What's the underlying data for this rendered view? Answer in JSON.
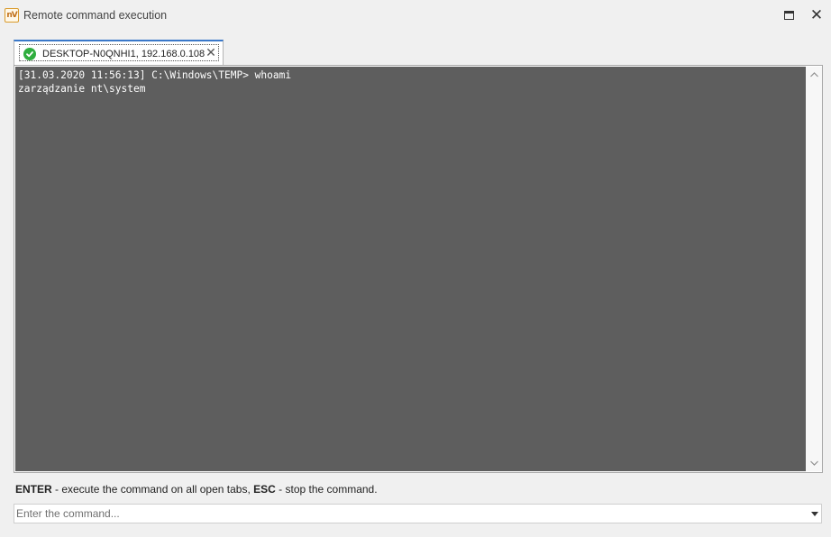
{
  "window": {
    "app_icon_text": "nV",
    "title": "Remote command execution"
  },
  "tabs": [
    {
      "label": "DESKTOP-N0QNHI1, 192.168.0.108",
      "status": "connected",
      "status_icon": "check-circle-icon",
      "close_glyph": "✕"
    }
  ],
  "terminal": {
    "lines": [
      "[31.03.2020 11:56:13] C:\\Windows\\TEMP> whoami",
      "zarządzanie nt\\system"
    ]
  },
  "hint": {
    "key1": "ENTER",
    "text1": " - execute the command on all open tabs, ",
    "key2": "ESC",
    "text2": " - stop the command."
  },
  "command": {
    "placeholder": "Enter the command...",
    "value": ""
  },
  "colors": {
    "terminal_bg": "#5e5e5e",
    "terminal_fg": "#ffffff",
    "tab_accent": "#3a78c9",
    "status_ok": "#2fae3e"
  }
}
